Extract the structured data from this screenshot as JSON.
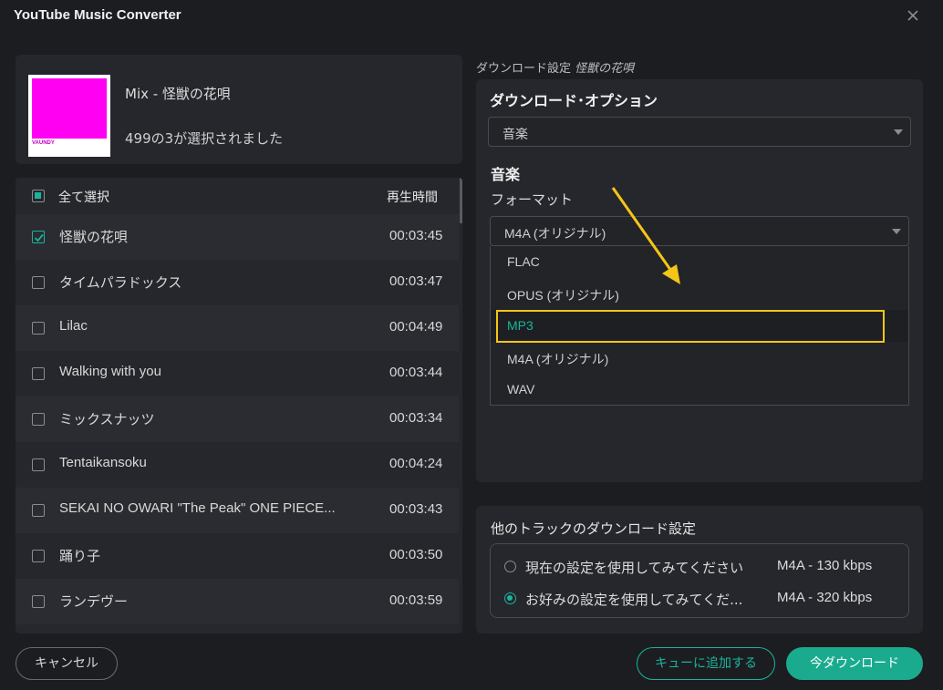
{
  "window": {
    "title": "YouTube Music Converter"
  },
  "album": {
    "title": "Mix - 怪獣の花唄",
    "selection_status": "499の3が選択されました",
    "cover_logo": "VAUNDY"
  },
  "track_list": {
    "select_all_label": "全て選択",
    "duration_header": "再生時間",
    "tracks": [
      {
        "name": "怪獣の花唄",
        "duration": "00:03:45",
        "checked": true
      },
      {
        "name": "タイムパラドックス",
        "duration": "00:03:47",
        "checked": false
      },
      {
        "name": "Lilac",
        "duration": "00:04:49",
        "checked": false
      },
      {
        "name": "Walking with you",
        "duration": "00:03:44",
        "checked": false
      },
      {
        "name": "ミックスナッツ",
        "duration": "00:03:34",
        "checked": false
      },
      {
        "name": "Tentaikansoku",
        "duration": "00:04:24",
        "checked": false
      },
      {
        "name": "SEKAI NO OWARI \"The Peak\" ONE PIECE...",
        "duration": "00:03:43",
        "checked": false
      },
      {
        "name": "踊り子",
        "duration": "00:03:50",
        "checked": false
      },
      {
        "name": "ランデヴー",
        "duration": "00:03:59",
        "checked": false
      }
    ]
  },
  "settings": {
    "caption_prefix": "ダウンロード設定 ",
    "caption_song": "怪獣の花唄",
    "download_option_title": "ダウンロード･オプション",
    "download_option_value": "音楽",
    "music_heading": "音楽",
    "format_label": "フォーマット",
    "format_value": "M4A (オリジナル)",
    "format_options": [
      {
        "label": "FLAC",
        "highlighted": false
      },
      {
        "label": "OPUS (オリジナル)",
        "highlighted": false
      },
      {
        "label": "MP3",
        "highlighted": true
      },
      {
        "label": "M4A (オリジナル)",
        "highlighted": false
      },
      {
        "label": "WAV",
        "highlighted": false
      }
    ],
    "annotation_color": "#f5c518"
  },
  "other_tracks": {
    "title": "他のトラックのダウンロード設定",
    "options": [
      {
        "label": "現在の設定を使用してみてください",
        "value": "M4A - 130 kbps",
        "selected": false
      },
      {
        "label": "お好みの設定を使用してみてくだ...",
        "value": "M4A - 320 kbps",
        "selected": true
      }
    ]
  },
  "buttons": {
    "cancel": "キャンセル",
    "add_to_queue": "キューに追加する",
    "download_now": "今ダウンロード"
  },
  "colors": {
    "accent": "#18b59b",
    "background": "#1c1d21",
    "panel": "#26272c"
  }
}
